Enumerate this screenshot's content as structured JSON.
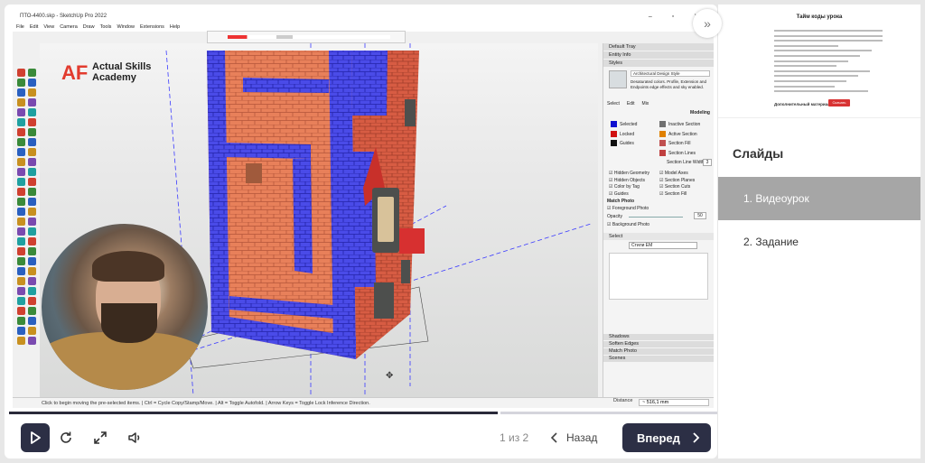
{
  "app": {
    "window_title": "ПТО-4400.skp - SketchUp Pro 2022",
    "menu": [
      "File",
      "Edit",
      "View",
      "Camera",
      "Draw",
      "Tools",
      "Window",
      "Extensions",
      "Help"
    ],
    "toolbar_labels": [
      "Now",
      "04:29 PM"
    ],
    "logo_line1": "Actual Skills",
    "logo_line2": "Academy"
  },
  "tray": {
    "title": "Default Tray",
    "entity_info": "Entity Info",
    "styles": "Styles",
    "style_name": "Architectural Design Style",
    "style_desc": "Desaturated colors. Profile, Extension and Endpoints edge effects and sky enabled.",
    "tabs": [
      "Select",
      "Edit",
      "Mix"
    ],
    "modeling": "Modeling",
    "colors": [
      {
        "label": "Selected",
        "color": "#1010d0"
      },
      {
        "label": "Locked",
        "color": "#d01010"
      },
      {
        "label": "Guides",
        "color": "#101010"
      },
      {
        "label": "Inactive Section",
        "color": "#707070"
      },
      {
        "label": "Active Section",
        "color": "#e08000"
      },
      {
        "label": "Section Fill",
        "color": "#c05050"
      },
      {
        "label": "Section Lines",
        "color": "#c04040"
      }
    ],
    "section_line_width_label": "Section Line Width",
    "section_line_width": "3",
    "checks_left": [
      "Hidden Geometry",
      "Hidden Objects",
      "Color by Tag",
      "Guides"
    ],
    "checks_right": [
      "Model Axes",
      "Section Planes",
      "Section Cuts",
      "Section Fill"
    ],
    "match_photo": "Match Photo",
    "foreground_photo": "Foreground Photo",
    "opacity_label": "Opacity",
    "opacity_value": "50",
    "background_photo": "Background Photo",
    "select_label": "Select",
    "style_dropdown": "Стили ЕМ",
    "bottom_sections": [
      "Shadows",
      "Soften Edges",
      "Match Photo",
      "Scenes"
    ]
  },
  "status": {
    "message": "Click to begin moving the pre-selected items. | Ctrl = Cycle Copy/Stamp/Move. | Alt = Toggle Autofold. | Arrow Keys = Toggle Lock Inference Direction.",
    "distance_label": "Distance",
    "distance_value": "~ 516,1 mm"
  },
  "controls": {
    "page_count": "1 из 2",
    "back_label": "Назад",
    "next_label": "Вперед",
    "progress": 0.69
  },
  "sidebar": {
    "doc_title": "Тайм коды урока",
    "doc_link": "Дополнительный материал:",
    "doc_button": "Скачать",
    "slides_title": "Слайды",
    "slides": [
      {
        "label": "1. Видеоурок",
        "active": true
      },
      {
        "label": "2. Задание",
        "active": false
      }
    ]
  }
}
